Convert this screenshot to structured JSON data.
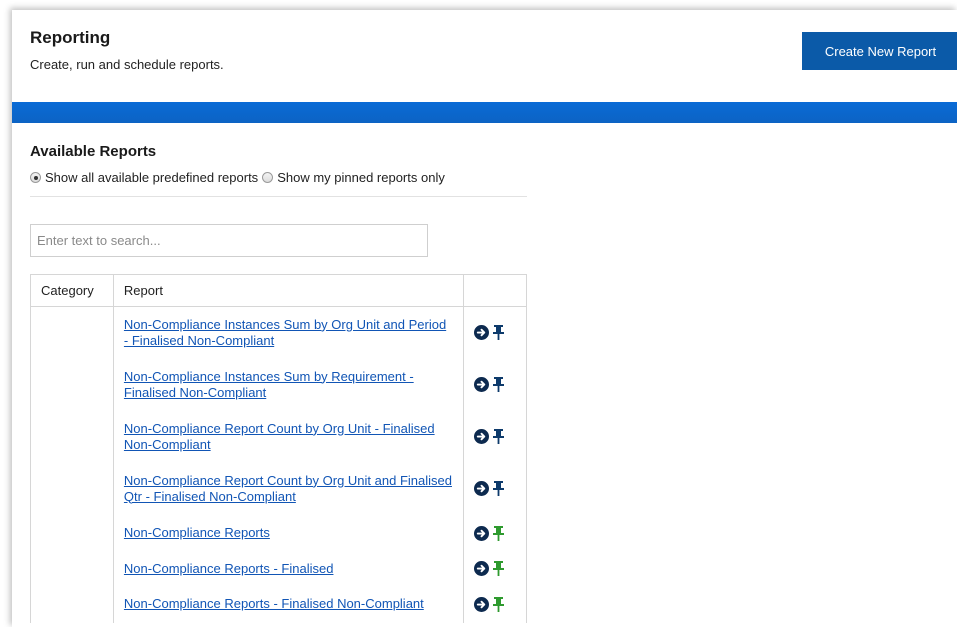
{
  "header": {
    "title": "Reporting",
    "subtitle": "Create, run and schedule reports.",
    "create_button_label": "Create New Report"
  },
  "colors": {
    "brand_blue": "#0b5aa8",
    "banner_blue": "#0a6bd6",
    "link_blue": "#1155b5",
    "pin_navy": "#0d3a6b",
    "pin_green": "#2e9a2e"
  },
  "available_reports": {
    "title": "Available Reports",
    "radio_all_label": "Show all available predefined reports",
    "radio_pinned_label": "Show my pinned reports only",
    "selected": "all"
  },
  "search": {
    "placeholder": "Enter text to search...",
    "value": ""
  },
  "table": {
    "columns": [
      "Category",
      "Report",
      ""
    ],
    "rows": [
      {
        "category": "",
        "report": "Non-Compliance Instances Sum by Org Unit and Period - Finalised Non-Compliant",
        "pinned": false
      },
      {
        "category": "",
        "report": "Non-Compliance Instances Sum by Requirement - Finalised Non-Compliant",
        "pinned": false
      },
      {
        "category": "",
        "report": "Non-Compliance Report Count by Org Unit - Finalised Non-Compliant",
        "pinned": false
      },
      {
        "category": "",
        "report": "Non-Compliance Report Count by Org Unit and Finalised Qtr - Finalised Non-Compliant",
        "pinned": false
      },
      {
        "category": "",
        "report": "Non-Compliance Reports",
        "pinned": true
      },
      {
        "category": "",
        "report": "Non-Compliance Reports - Finalised",
        "pinned": true
      },
      {
        "category": "",
        "report": "Non-Compliance Reports - Finalised Non-Compliant",
        "pinned": true
      }
    ]
  }
}
